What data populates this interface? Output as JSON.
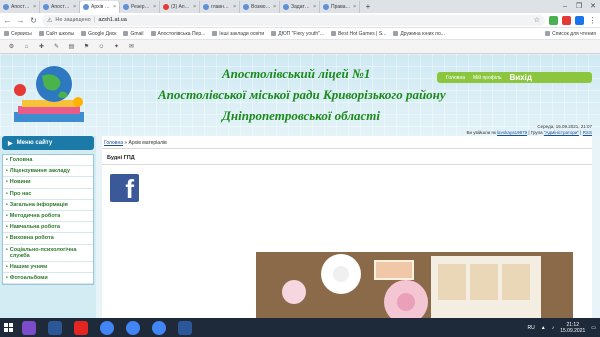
{
  "browser": {
    "tabs": [
      {
        "label": "Апостолівсь",
        "active": false
      },
      {
        "label": "Апостолівсь",
        "active": false
      },
      {
        "label": "Архів матер",
        "active": true
      },
      {
        "label": "Резервни",
        "active": false
      },
      {
        "label": "(3) Апостол",
        "active": false
      },
      {
        "label": "главную с",
        "active": false
      },
      {
        "label": "Возможн",
        "active": false
      },
      {
        "label": "Задать во",
        "active": false
      },
      {
        "label": "Права по",
        "active": false
      }
    ],
    "new_tab": "+",
    "security_label": "Не защищено",
    "url": "azsh1.at.ua",
    "bookmarks": [
      "Сервисы",
      "Сайт школы",
      "Google Диск",
      "Gmail",
      "Апостолівська Пер...",
      "Інші заклади освіти",
      "ДЮП \"Fiery youth\"...",
      "Best Hot Games | S...",
      "Дружина юних по..."
    ],
    "bookmarks_right": "Список для чтения"
  },
  "site": {
    "title_line1": "Апостолівський ліцей №1",
    "title_line2": "Апостолівської міської ради Криворізького району",
    "title_line3": "Дніпропетровської області",
    "nav_home": "Головна",
    "nav_profile": "Мій профіль",
    "nav_exit": "Вихід",
    "date": "Середа, 15.09.2021, 21:07",
    "greeting_prefix": "Ви увійшли як",
    "username": "lavskaya19879",
    "group_prefix": "| Група",
    "group": "\"Адміністратори\"",
    "rss": "RSS",
    "menu_title": "Меню сайту",
    "menu_items": [
      "Головна",
      "Ліцензування закладу",
      "Новини",
      "Про нас",
      "Загальна інформація",
      "Методична робота",
      "Навчальна робота",
      "Виховна робота",
      "Соціально-психологічна служба",
      "Нашим учням",
      "Фотоальбоми"
    ],
    "breadcrumb_home": "Головна",
    "breadcrumb_current": "» Архів матеріалів",
    "page_title": "Будні ГПД",
    "facebook_glyph": "f"
  },
  "taskbar": {
    "lang": "RU",
    "time": "21:12",
    "date": "15.09.2021"
  },
  "colors": {
    "title_green": "#1a8a1a",
    "menu_blue": "#1c7aa8",
    "nav_green": "#8cc63f",
    "facebook": "#3b5998"
  }
}
